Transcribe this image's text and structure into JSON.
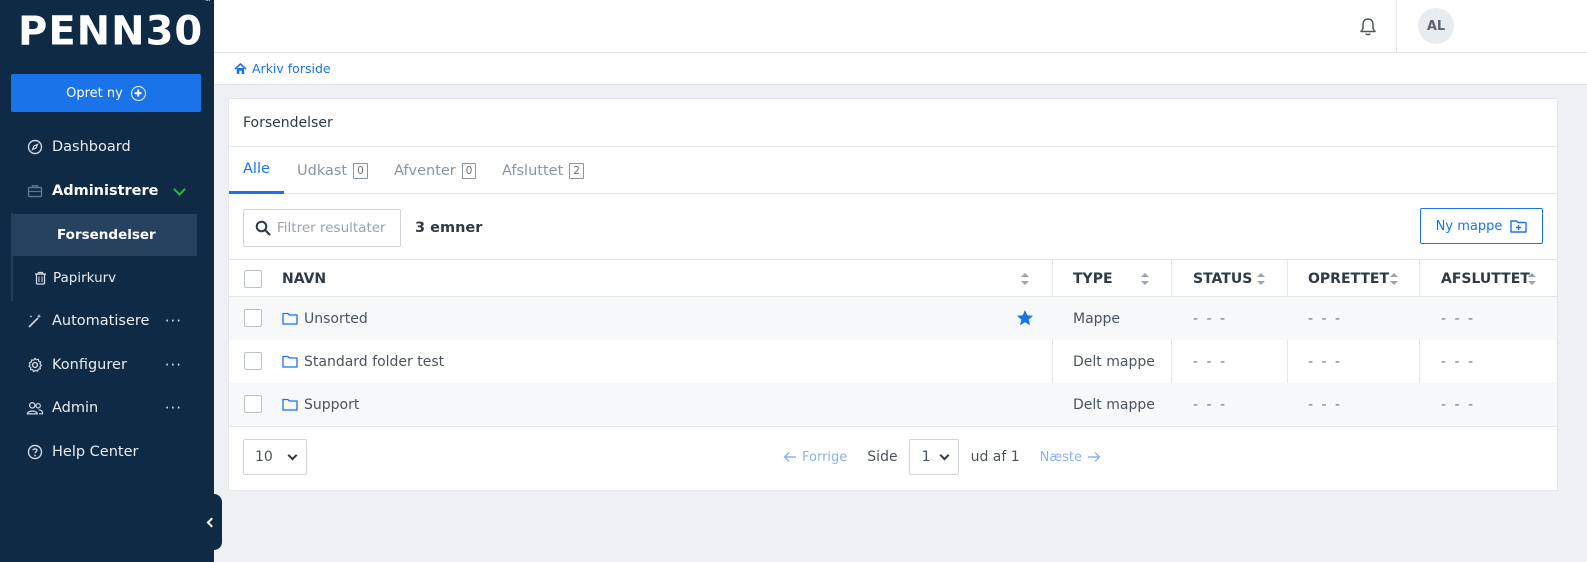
{
  "brand": {
    "logo_text": "PENN30",
    "tm": "™"
  },
  "sidebar": {
    "create_label": "Opret ny",
    "items": [
      {
        "label": "Dashboard",
        "icon": "compass-icon"
      },
      {
        "label": "Administrere",
        "icon": "briefcase-icon"
      },
      {
        "label": "Automatisere",
        "icon": "magic-wand-icon"
      },
      {
        "label": "Konfigurer",
        "icon": "gear-icon"
      },
      {
        "label": "Admin",
        "icon": "users-icon"
      },
      {
        "label": "Help Center",
        "icon": "help-circle-icon"
      }
    ],
    "subitems": [
      {
        "label": "Forsendelser"
      },
      {
        "label": "Papirkurv",
        "icon": "trash-icon"
      }
    ],
    "more": "···"
  },
  "topbar": {
    "avatar_initials": "AL"
  },
  "breadcrumb": {
    "label": "Arkiv forside"
  },
  "card": {
    "title": "Forsendelser",
    "tabs": [
      {
        "label": "Alle"
      },
      {
        "label": "Udkast",
        "count": "0"
      },
      {
        "label": "Afventer",
        "count": "0"
      },
      {
        "label": "Afsluttet",
        "count": "2"
      }
    ],
    "filter_placeholder": "Filtrer resultater",
    "count_label": "3 emner",
    "new_folder_label": "Ny mappe",
    "columns": [
      "NAVN",
      "TYPE",
      "STATUS",
      "OPRETTET",
      "AFSLUTTET"
    ],
    "rows": [
      {
        "name": "Unsorted",
        "type": "Mappe",
        "status": "- - -",
        "created": "- - -",
        "completed": "- - -",
        "starred": true
      },
      {
        "name": "Standard folder test",
        "type": "Delt mappe",
        "status": "- - -",
        "created": "- - -",
        "completed": "- - -",
        "starred": false
      },
      {
        "name": "Support",
        "type": "Delt mappe",
        "status": "- - -",
        "created": "- - -",
        "completed": "- - -",
        "starred": false
      }
    ],
    "page_size": "10",
    "prev_label": "Forrige",
    "page_label": "Side",
    "page_value": "1",
    "of_label": "ud af 1",
    "next_label": "Næste"
  },
  "colors": {
    "sidebar": "#0f2a44",
    "accent": "#1a73e8",
    "success": "#2db34a"
  }
}
